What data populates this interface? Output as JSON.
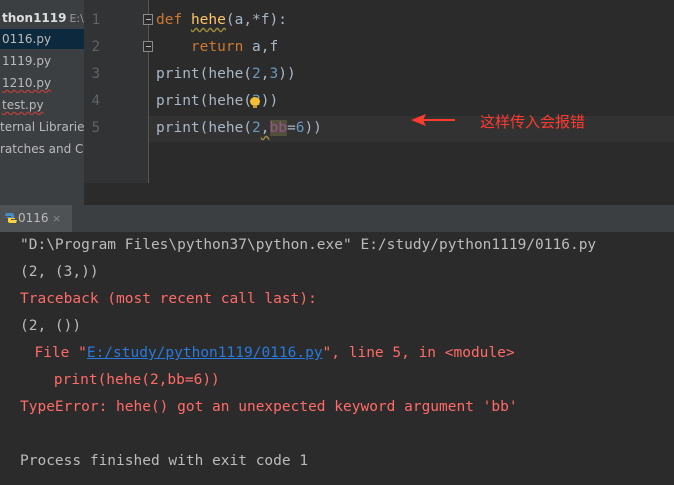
{
  "project": {
    "root_name": "thon1119",
    "root_path": "E:\\stu",
    "files": [
      {
        "name": "0116.py",
        "selected": true
      },
      {
        "name": "1119.py",
        "selected": false
      },
      {
        "name": "1210.py",
        "selected": false
      },
      {
        "name": "test.py",
        "selected": false
      }
    ],
    "external_libraries": "ternal Libraries",
    "scratches": "ratches and Con"
  },
  "editor": {
    "line_numbers": [
      "1",
      "2",
      "3",
      "4",
      "5"
    ],
    "lines": {
      "l1": {
        "kw": "def",
        "fn": "hehe",
        "sig": "(a,*f):"
      },
      "l2": {
        "kw": "return",
        "rest": "a,f"
      },
      "l3": {
        "fn": "print",
        "a": "(hehe(",
        "n1": "2",
        "c": ",",
        "n2": "3",
        "e": "))"
      },
      "l4": {
        "fn": "print",
        "a": "(hehe(",
        "n1": "2",
        "e": "))"
      },
      "l5": {
        "fn": "print",
        "a": "(hehe(",
        "n1": "2",
        "c": ",",
        "kwarg": "bb",
        "eq": "=",
        "n2": "6",
        "e": "))"
      }
    },
    "annotation": "这样传入会报错",
    "colors": {
      "keyword": "#cc7832",
      "function": "#ffc66d",
      "number": "#6897bb",
      "annotation": "#ff3b30"
    }
  },
  "run": {
    "tab_label": "0116",
    "tab_close": "×",
    "output": {
      "cmd": "\"D:\\Program Files\\python37\\python.exe\" E:/study/python1119/0116.py",
      "out1": "(2, (3,))",
      "traceback": "Traceback (most recent call last):",
      "out2": "(2, ())",
      "file_prefix": "  File \"",
      "file_link": "E:/study/python1119/0116.py",
      "file_suffix": "\", line 5, in <module>",
      "code": "    print(hehe(2,bb=6))",
      "error": "TypeError: hehe() got an unexpected keyword argument 'bb'",
      "exit": "Process finished with exit code 1"
    },
    "colors": {
      "error": "#ff6b68",
      "link": "#287bde",
      "normal": "#bbbbbb"
    }
  }
}
